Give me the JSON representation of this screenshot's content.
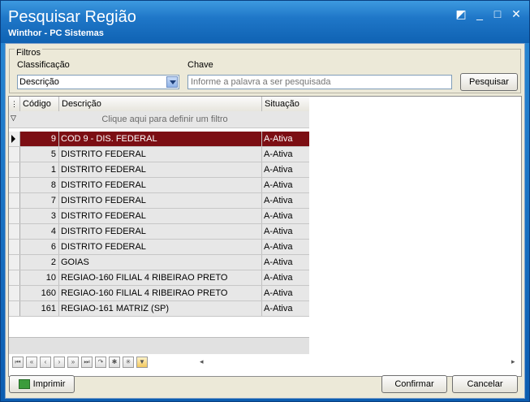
{
  "window": {
    "title": "Pesquisar Região",
    "subtitle": "Winthor - PC Sistemas",
    "controls": [
      "◩",
      "_",
      "□",
      "✕"
    ]
  },
  "filtros": {
    "legend": "Filtros",
    "classificacao_label": "Classificação",
    "classificacao_value": "Descrição",
    "chave_label": "Chave",
    "chave_placeholder": "Informe a palavra a ser pesquisada",
    "pesquisar_label": "Pesquisar"
  },
  "grid": {
    "columns": [
      "Código",
      "Descrição",
      "Situação"
    ],
    "filter_hint": "Clique aqui para definir um filtro",
    "rows": [
      {
        "codigo": "9",
        "descricao": "COD 9 - DIS. FEDERAL",
        "situacao": "A-Ativa",
        "selected": true
      },
      {
        "codigo": "5",
        "descricao": "DISTRITO FEDERAL",
        "situacao": "A-Ativa"
      },
      {
        "codigo": "1",
        "descricao": "DISTRITO FEDERAL",
        "situacao": "A-Ativa"
      },
      {
        "codigo": "8",
        "descricao": "DISTRITO FEDERAL",
        "situacao": "A-Ativa"
      },
      {
        "codigo": "7",
        "descricao": "DISTRITO FEDERAL",
        "situacao": "A-Ativa"
      },
      {
        "codigo": "3",
        "descricao": "DISTRITO FEDERAL",
        "situacao": "A-Ativa"
      },
      {
        "codigo": "4",
        "descricao": "DISTRITO FEDERAL",
        "situacao": "A-Ativa"
      },
      {
        "codigo": "6",
        "descricao": "DISTRITO FEDERAL",
        "situacao": "A-Ativa"
      },
      {
        "codigo": "2",
        "descricao": "GOIAS",
        "situacao": "A-Ativa"
      },
      {
        "codigo": "10",
        "descricao": "REGIAO-160 FILIAL 4 RIBEIRAO PRETO",
        "situacao": "A-Ativa"
      },
      {
        "codigo": "160",
        "descricao": "REGIAO-160 FILIAL 4 RIBEIRAO PRETO",
        "situacao": "A-Ativa"
      },
      {
        "codigo": "161",
        "descricao": "REGIAO-161 MATRIZ  (SP)",
        "situacao": "A-Ativa"
      }
    ]
  },
  "navigator": {
    "buttons": [
      "⏮",
      "«",
      "‹",
      "›",
      "»",
      "⏭",
      "↷",
      "✱",
      "✳",
      "▼"
    ]
  },
  "actions": {
    "imprimir": "Imprimir",
    "confirmar": "Confirmar",
    "cancelar": "Cancelar"
  },
  "colors": {
    "selected_row": "#7c0e13",
    "title_bar": "#1f77c8"
  }
}
